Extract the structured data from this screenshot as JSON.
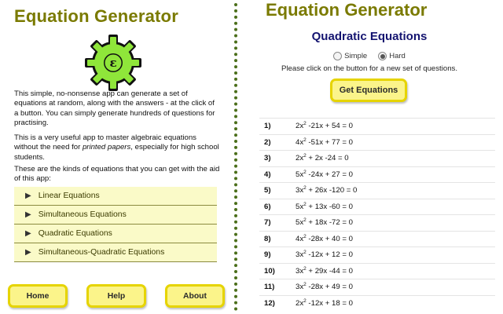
{
  "left": {
    "app_title": "Equation Generator",
    "logo_letter": "ε",
    "desc1": "This simple, no-nonsense app can generate a set of equations at random, along with the answers - at the click of a button. You can simply generate hundreds of questions for practising.",
    "desc2_a": "This is a very useful app to master algebraic equations without the need for ",
    "desc2_em": "printed papers",
    "desc2_b": ", especially for high school students.",
    "desc3": "These are the kinds of equations that you can get with the aid of this app:",
    "kinds": [
      {
        "label": "Linear Equations"
      },
      {
        "label": "Simultaneous Equations"
      },
      {
        "label": "Quadratic Equations"
      },
      {
        "label": "Simultaneous-Quadratic Equations"
      }
    ],
    "nav": {
      "home": "Home",
      "help": "Help",
      "about": "About"
    }
  },
  "right": {
    "app_title": "Equation Generator",
    "subtitle": "Quadratic Equations",
    "radio_simple": "Simple",
    "radio_hard": "Hard",
    "selected_difficulty": "Hard",
    "instruction": "Please click on the button for a new set of questions.",
    "get_button": "Get Equations",
    "equations": [
      {
        "num": "1)",
        "coef": "2x",
        "rest": " -21x + 54 = 0"
      },
      {
        "num": "2)",
        "coef": "4x",
        "rest": " -51x + 77 = 0"
      },
      {
        "num": "3)",
        "coef": "2x",
        "rest": " + 2x -24 = 0"
      },
      {
        "num": "4)",
        "coef": "5x",
        "rest": " -24x + 27 = 0"
      },
      {
        "num": "5)",
        "coef": "3x",
        "rest": " + 26x -120 = 0"
      },
      {
        "num": "6)",
        "coef": "5x",
        "rest": " + 13x -60 = 0"
      },
      {
        "num": "7)",
        "coef": "5x",
        "rest": " + 18x -72 = 0"
      },
      {
        "num": "8)",
        "coef": "4x",
        "rest": " -28x + 40 = 0"
      },
      {
        "num": "9)",
        "coef": "3x",
        "rest": " -12x + 12 = 0"
      },
      {
        "num": "10)",
        "coef": "3x",
        "rest": " + 29x -44 = 0"
      },
      {
        "num": "11)",
        "coef": "3x",
        "rest": " -28x + 49 = 0"
      },
      {
        "num": "12)",
        "coef": "2x",
        "rest": " -12x + 18 = 0"
      }
    ],
    "exponent": "2"
  }
}
